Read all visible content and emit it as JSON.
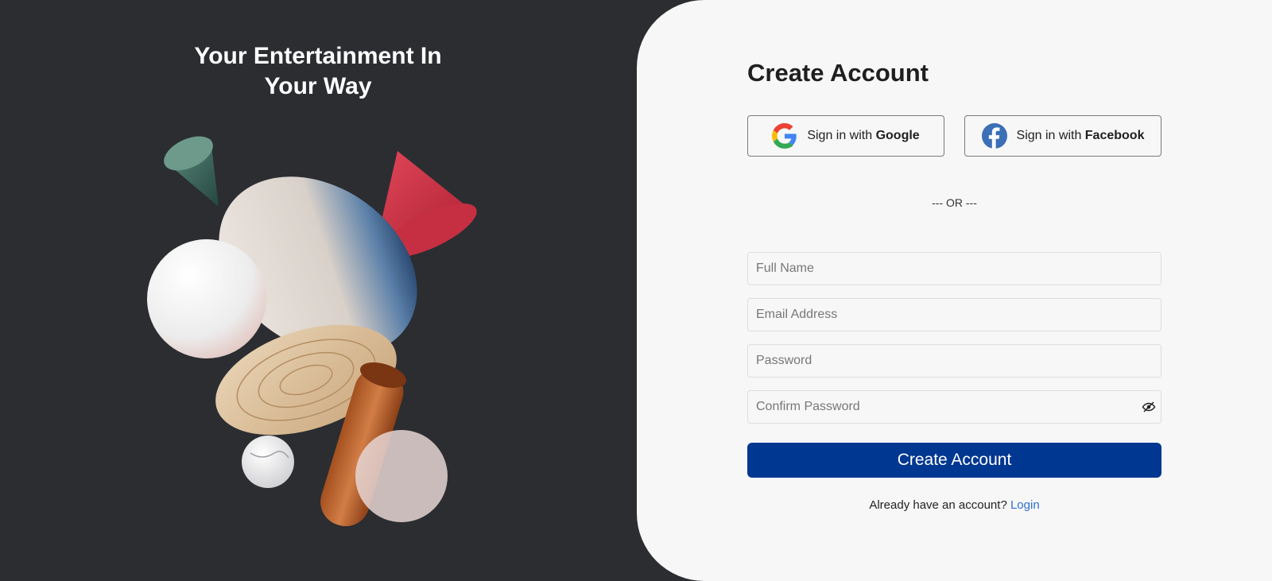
{
  "hero": {
    "title_line1": "Your Entertainment In",
    "title_line2": "Your Way"
  },
  "form": {
    "title": "Create Account",
    "google": {
      "prefix": "Sign in with ",
      "brand": "Google",
      "icon": "google-icon"
    },
    "facebook": {
      "prefix": "Sign in with ",
      "brand": "Facebook",
      "icon": "facebook-icon"
    },
    "or_separator": "--- OR ---",
    "fields": {
      "full_name": {
        "placeholder": "Full Name",
        "value": ""
      },
      "email": {
        "placeholder": "Email Address",
        "value": ""
      },
      "password": {
        "placeholder": "Password",
        "value": ""
      },
      "confirm_password": {
        "placeholder": "Confirm Password",
        "value": ""
      }
    },
    "submit_label": "Create Account",
    "login_prompt": "Already have an account?",
    "login_link": "Login"
  },
  "colors": {
    "left_background": "#2b2d31",
    "right_background": "#f7f7f7",
    "primary_button": "#003791",
    "link": "#2f6fd1"
  }
}
